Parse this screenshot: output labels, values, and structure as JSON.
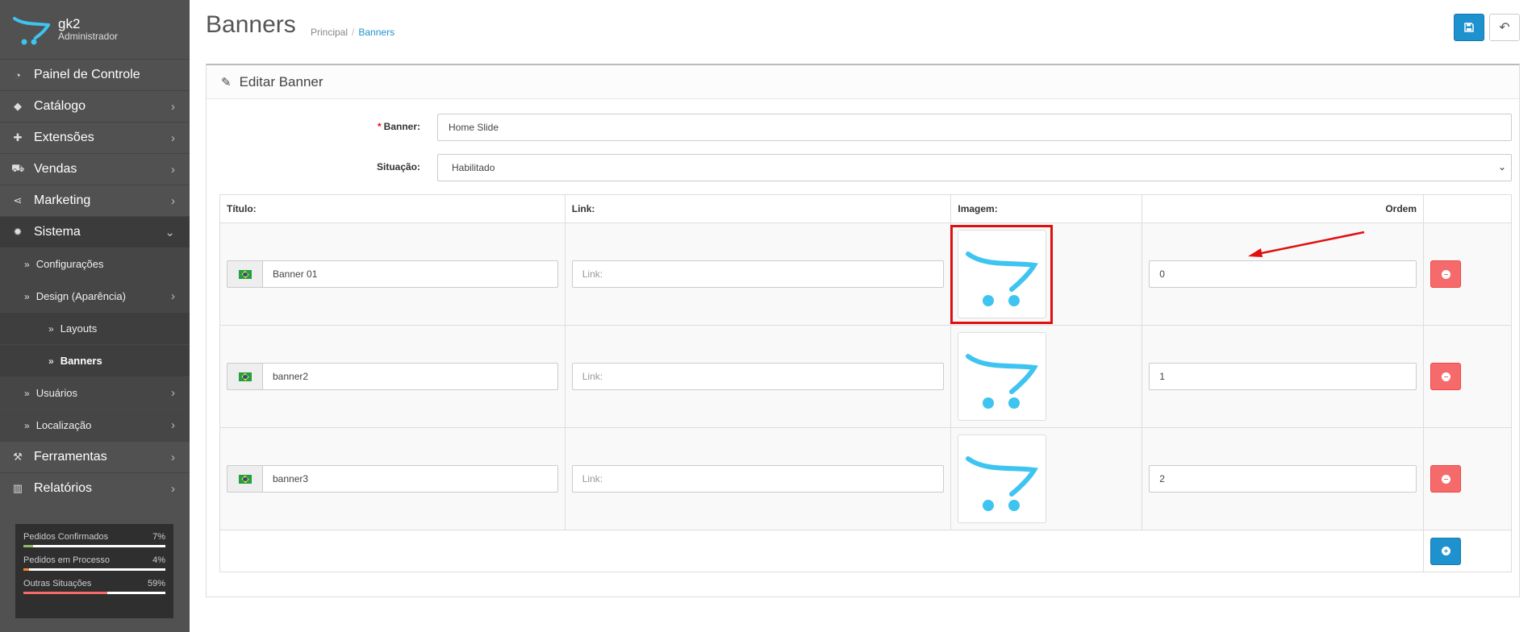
{
  "sidebar": {
    "user": "gk2",
    "role": "Administrador",
    "menu": [
      {
        "label": "Painel de Controle",
        "icon": "dashboard-icon"
      },
      {
        "label": "Catálogo",
        "icon": "tags-icon"
      },
      {
        "label": "Extensões",
        "icon": "puzzle-icon"
      },
      {
        "label": "Vendas",
        "icon": "cart-icon"
      },
      {
        "label": "Marketing",
        "icon": "share-icon"
      },
      {
        "label": "Sistema",
        "icon": "cog-icon"
      }
    ],
    "submenu": [
      {
        "label": "Configurações"
      },
      {
        "label": "Design (Aparência)"
      },
      {
        "label": "Layouts"
      },
      {
        "label": "Banners"
      },
      {
        "label": "Usuários"
      },
      {
        "label": "Localização"
      }
    ],
    "menu_bottom": [
      {
        "label": "Ferramentas",
        "icon": "wrench-icon"
      },
      {
        "label": "Relatórios",
        "icon": "chart-icon"
      }
    ],
    "stats": [
      {
        "label": "Pedidos Confirmados",
        "value": "7%",
        "percent": 7,
        "color": "#8fbb6c"
      },
      {
        "label": "Pedidos em Processo",
        "value": "4%",
        "percent": 4,
        "color": "#f38733"
      },
      {
        "label": "Outras Situações",
        "value": "59%",
        "percent": 59,
        "color": "#f56b6b"
      }
    ]
  },
  "header": {
    "title": "Banners",
    "breadcrumb": [
      "Principal",
      "Banners"
    ]
  },
  "panel": {
    "title": "Editar Banner"
  },
  "form": {
    "banner_label": "Banner:",
    "banner_value": "Home Slide",
    "status_label": "Situação:",
    "status_value": "Habilitado"
  },
  "table": {
    "headers": [
      "Título:",
      "Link:",
      "Imagem:",
      "Ordem"
    ],
    "link_placeholder": "Link:",
    "rows": [
      {
        "title": "Banner 01",
        "link": "",
        "order": "0"
      },
      {
        "title": "banner2",
        "link": "",
        "order": "1"
      },
      {
        "title": "banner3",
        "link": "",
        "order": "2"
      }
    ]
  },
  "colors": {
    "primary": "#1e91cf",
    "danger": "#f56b6b",
    "sidebar": "#515151",
    "highlight": "#e01010",
    "logo": "#3ec4f0"
  }
}
